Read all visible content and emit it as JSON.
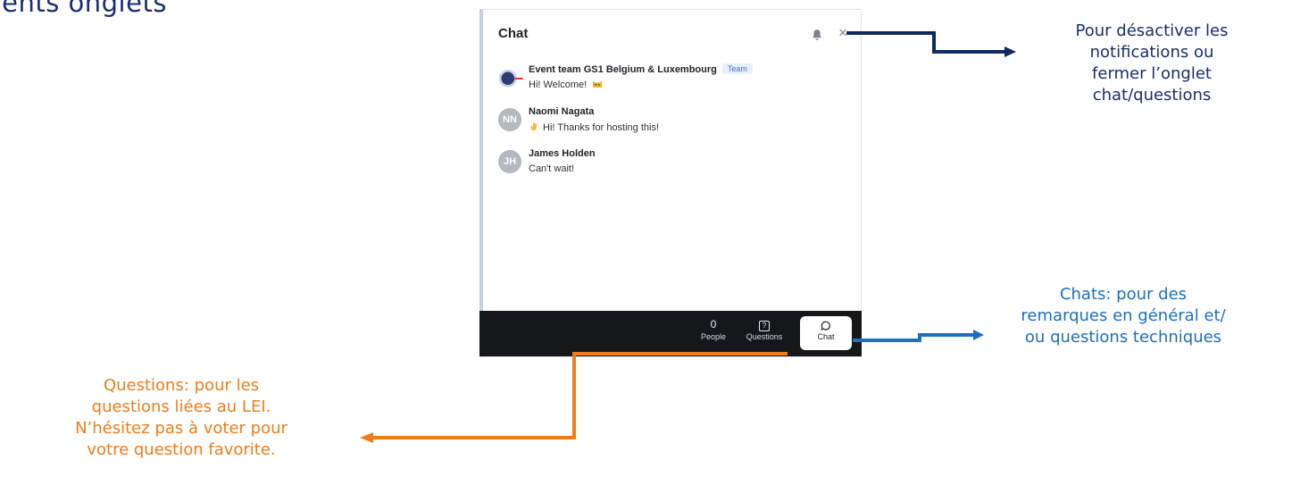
{
  "slide": {
    "title": "ifférents onglets"
  },
  "panel": {
    "title": "Chat",
    "close_glyph": "×",
    "icons": {
      "notifications": "bell-icon",
      "close": "close-icon"
    },
    "messages": [
      {
        "author": "Event team GS1 Belgium & Luxembourg",
        "badge": "Team",
        "text": "Hi! Welcome!",
        "emoji": "cat-face-emoji",
        "avatar": "GS1-logo"
      },
      {
        "author": "Naomi Nagata",
        "initials": "NN",
        "text": "Hi! Thanks for hosting this!",
        "emoji": "waving-hand-emoji"
      },
      {
        "author": "James Holden",
        "initials": "JH",
        "text": "Can't wait!"
      }
    ],
    "tabs": [
      {
        "top": "0",
        "label": "People"
      },
      {
        "icon": "question-icon",
        "label": "Questions"
      },
      {
        "icon": "chat-bubble-icon",
        "label": "Chat",
        "active": true
      }
    ]
  },
  "annotations": {
    "notifications": [
      "Pour désactiver les",
      "notifications ou",
      "fermer l’onglet",
      "chat/questions"
    ],
    "chat": [
      "Chats: pour des",
      "remarques en général et/",
      "ou questions techniques"
    ],
    "questions": [
      "Questions: pour les",
      "questions liées au LEI.",
      "N’hésitez pas à voter pour",
      "votre question favorite."
    ]
  },
  "colors": {
    "notifications_arrow": "#0e2a5e",
    "chat_arrow": "#1e6fbf",
    "questions_arrow": "#f07d1a",
    "tabbar": "#15171b"
  }
}
